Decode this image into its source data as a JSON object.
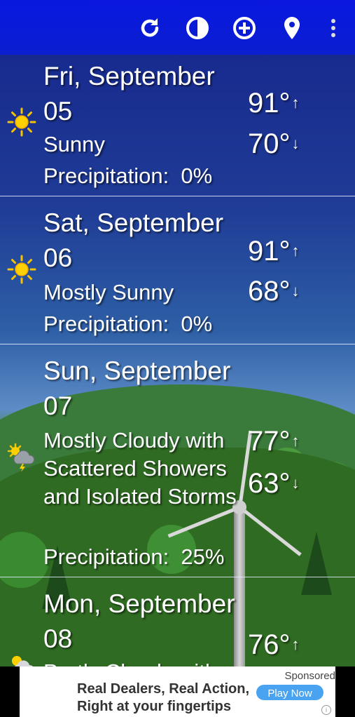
{
  "days": [
    {
      "date": "Fri, September 05",
      "condition": "Sunny",
      "precip_label": "Precipitation:  0%",
      "high": "91°",
      "low": "70°",
      "icon": "sunny-icon"
    },
    {
      "date": "Sat, September 06",
      "condition": "Mostly Sunny",
      "precip_label": "Precipitation:  0%",
      "high": "91°",
      "low": "68°",
      "icon": "sunny-icon"
    },
    {
      "date": "Sun, September 07",
      "condition": "Mostly Cloudy with Scattered Showers and Isolated Storms",
      "precip_label": "Precipitation:  25%",
      "high": "77°",
      "low": "63°",
      "icon": "thunderstorm-icon"
    },
    {
      "date": "Mon, September 08",
      "condition": "Partly Cloudy with",
      "high": "76°",
      "icon": "partly-cloudy-icon"
    }
  ],
  "arrows": {
    "up": "↑",
    "down": "↓"
  },
  "ad": {
    "line1": "Real Dealers, Real Action,",
    "line2": "Right at your fingertips",
    "sponsored": "Sponsored",
    "cta": "Play Now"
  },
  "colors": {
    "topbar": "#0b1ed0",
    "sun": "#f5c400",
    "text": "#ffffff"
  }
}
